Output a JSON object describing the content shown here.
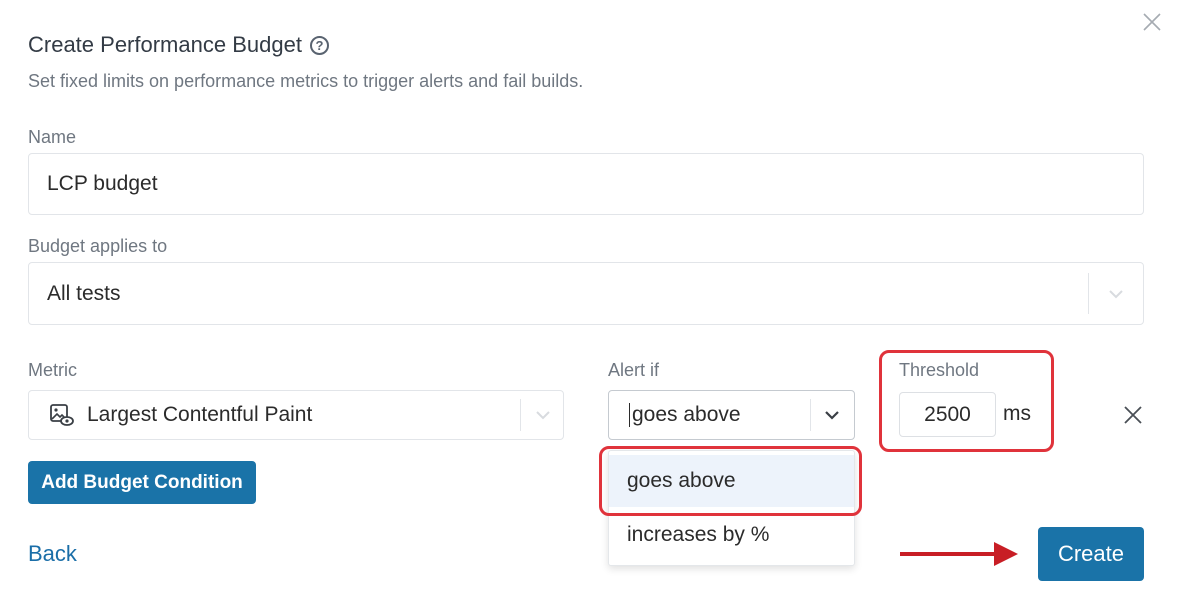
{
  "modal": {
    "title": "Create Performance Budget",
    "subtitle": "Set fixed limits on performance metrics to trigger alerts and fail builds."
  },
  "name_field": {
    "label": "Name",
    "value": "LCP budget"
  },
  "applies_field": {
    "label": "Budget applies to",
    "value": "All tests"
  },
  "metric_field": {
    "label": "Metric",
    "value": "Largest Contentful Paint",
    "icon": "image-eye-icon"
  },
  "alert_field": {
    "label": "Alert if",
    "value": "goes above"
  },
  "threshold_field": {
    "label": "Threshold",
    "value": "2500",
    "unit": "ms"
  },
  "dropdown": {
    "options": [
      "goes above",
      "increases by %"
    ],
    "selected_index": 0
  },
  "buttons": {
    "add_condition": "Add Budget Condition",
    "back": "Back",
    "create": "Create"
  },
  "colors": {
    "primary": "#1a73a8",
    "highlight": "#e0333b",
    "arrow": "#c81e25",
    "link": "#1a6ea8"
  }
}
